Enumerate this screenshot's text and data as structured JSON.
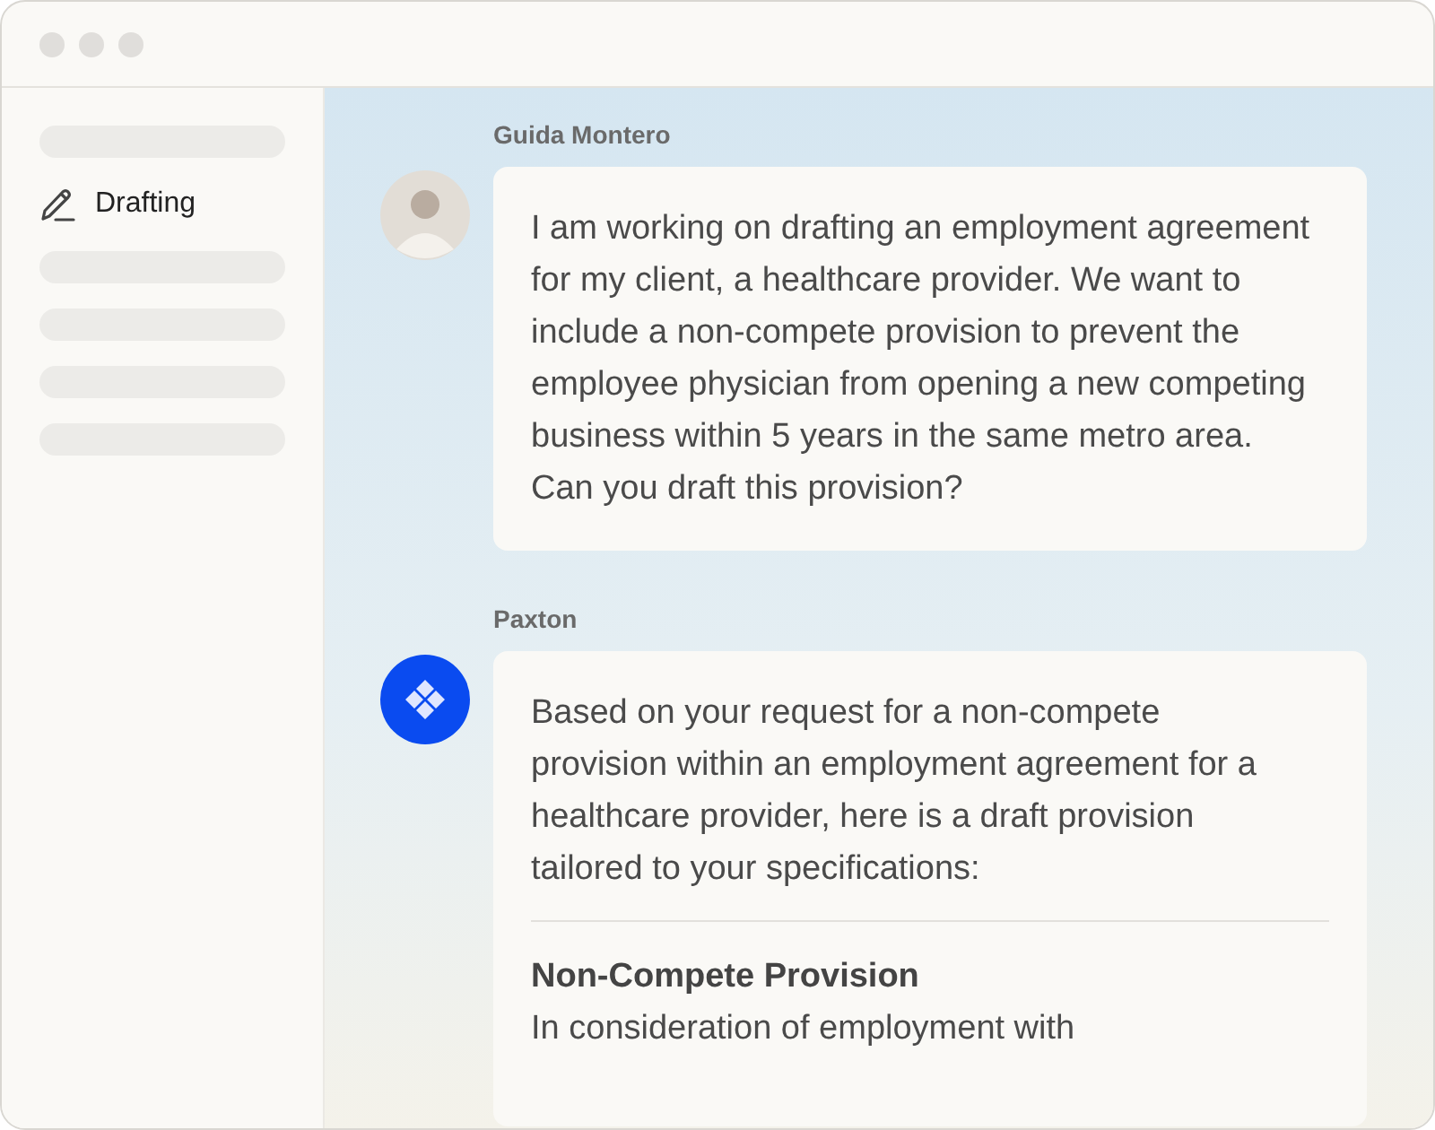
{
  "sidebar": {
    "items": [
      {
        "kind": "skeleton"
      },
      {
        "kind": "link",
        "label": "Drafting"
      },
      {
        "kind": "skeleton"
      },
      {
        "kind": "skeleton"
      },
      {
        "kind": "skeleton"
      },
      {
        "kind": "skeleton"
      }
    ]
  },
  "messages": [
    {
      "sender": "Guida Montero",
      "kind": "user",
      "blocks": [
        {
          "kind": "paragraph",
          "text": "I am working on drafting an employment agreement for my client, a healthcare provider. We want to include a non-compete provision to prevent the employee physician from opening a new competing business within 5 years in the same metro area."
        },
        {
          "kind": "paragraph",
          "text": "Can you draft this provision?"
        }
      ]
    },
    {
      "sender": "Paxton",
      "kind": "assistant",
      "blocks": [
        {
          "kind": "paragraph",
          "text": "Based on your request for a non-compete provision within an employment agreement for a healthcare provider, here is a draft provision tailored to your specifications:"
        },
        {
          "kind": "divider"
        },
        {
          "kind": "heading",
          "text": "Non-Compete Provision"
        },
        {
          "kind": "paragraph",
          "text": "In consideration of employment with"
        }
      ]
    }
  ]
}
